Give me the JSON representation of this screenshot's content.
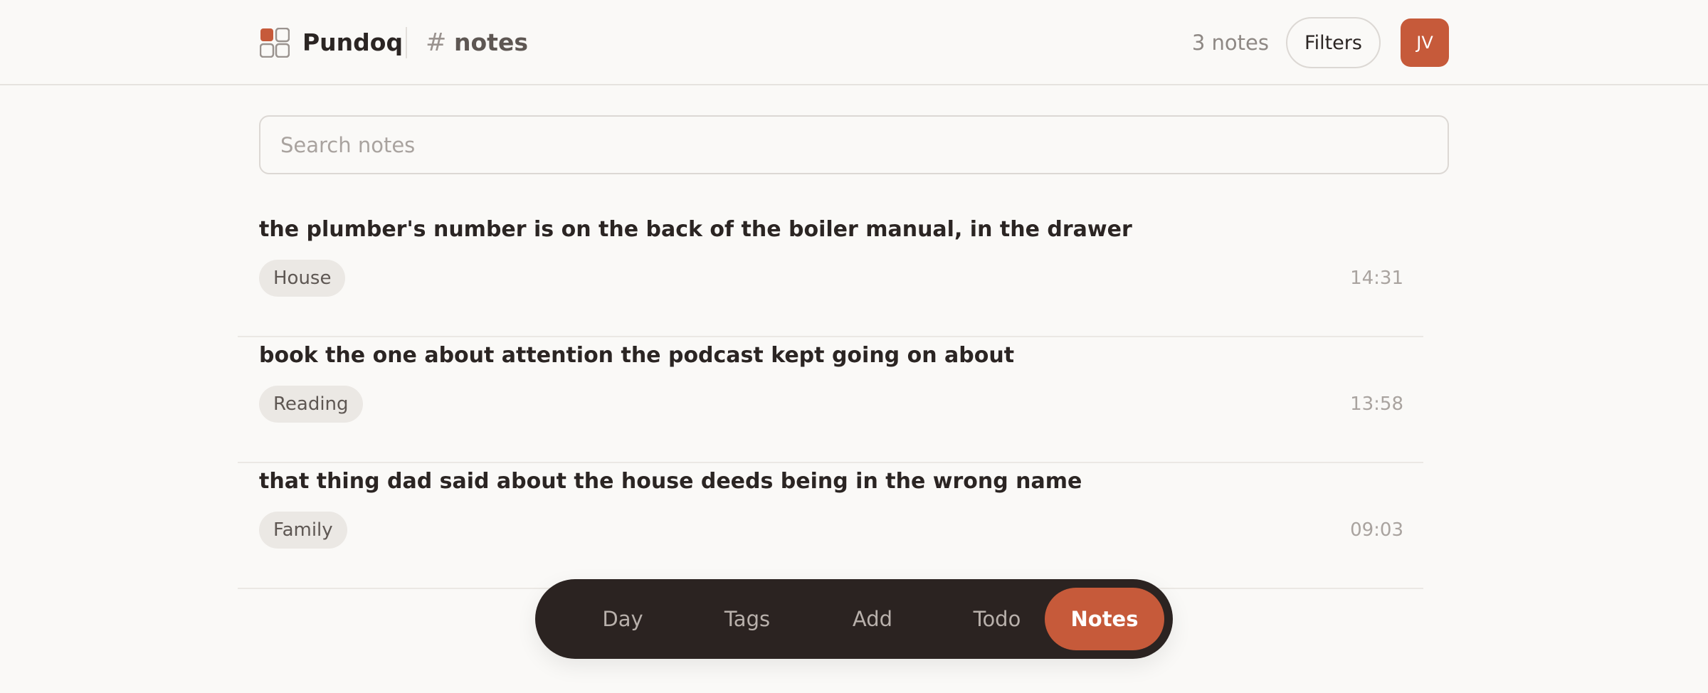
{
  "app": {
    "name": "Pundoq",
    "channel_symbol": "#",
    "channel": "notes",
    "note_count": "3 notes",
    "filters_label": "Filters",
    "user_initials": "JV",
    "accent_color": "#c65a3a"
  },
  "search": {
    "placeholder": "Search notes",
    "value": ""
  },
  "notes": [
    {
      "text": "the plumber's number is on the back of the boiler manual, in the drawer",
      "tag": "House",
      "time": "14:31"
    },
    {
      "text": "book the one about attention the podcast kept going on about",
      "tag": "Reading",
      "time": "13:58"
    },
    {
      "text": "that thing dad said about the house deeds being in the wrong name",
      "tag": "Family",
      "time": "09:03"
    }
  ],
  "nav": {
    "items": [
      {
        "label": "Day"
      },
      {
        "label": "Tags"
      },
      {
        "label": "Add"
      },
      {
        "label": "Todo"
      },
      {
        "label": "Notes"
      }
    ],
    "active": "Notes"
  }
}
